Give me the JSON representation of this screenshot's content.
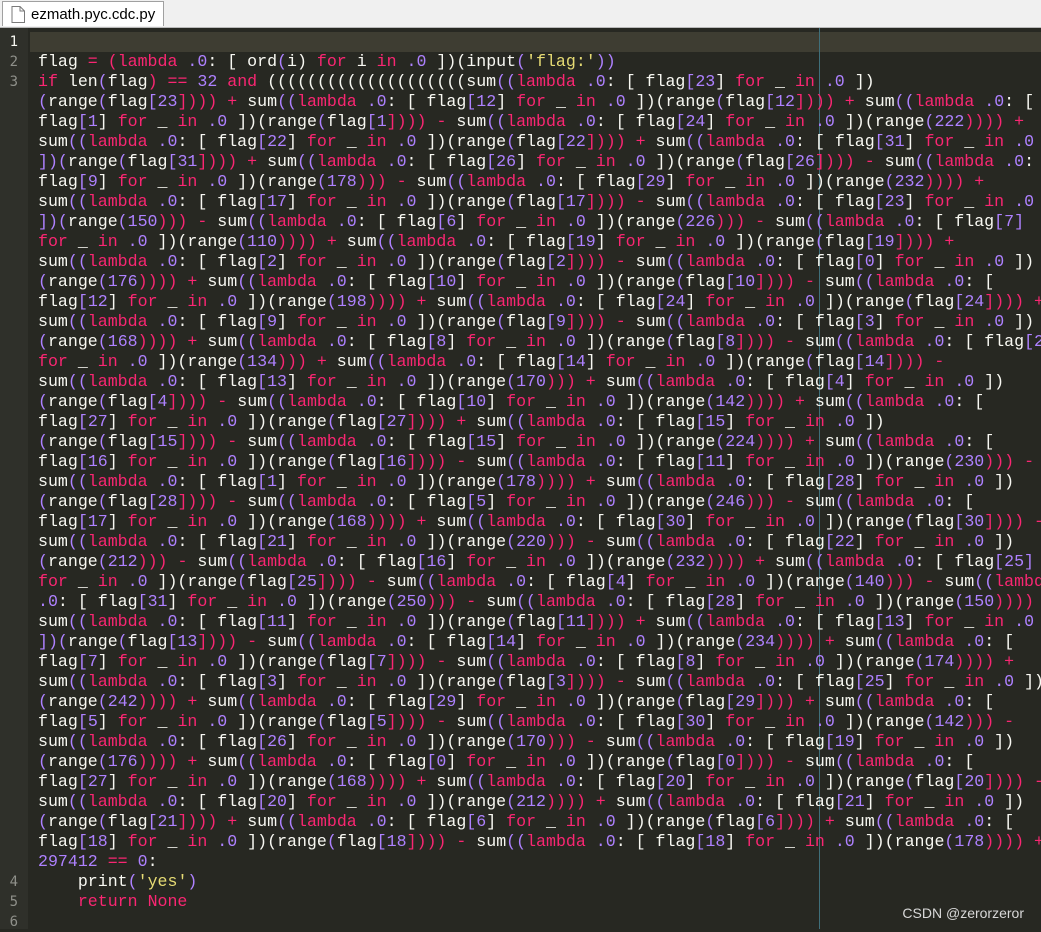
{
  "tab": {
    "title": "ezmath.pyc.cdc.py",
    "icon": "file-icon"
  },
  "gutter": {
    "line_numbers": [
      "1",
      "2",
      "3",
      "4",
      "5",
      "6"
    ]
  },
  "code": {
    "line2": "flag = (lambda .0: [ ord(i) for i in .0 ])(input('flag:'))",
    "line3_wrapped": [
      "if len(flag) == 32 and ((((((((((((((((((((sum((lambda .0: [ flag[23] for _ in .0 ])",
      "(range(flag[23]))) + sum((lambda .0: [ flag[12] for _ in .0 ])(range(flag[12]))) + sum((lambda .0: [",
      "flag[1] for _ in .0 ])(range(flag[1]))) - sum((lambda .0: [ flag[24] for _ in .0 ])(range(222)))) +",
      "sum((lambda .0: [ flag[22] for _ in .0 ])(range(flag[22]))) + sum((lambda .0: [ flag[31] for _ in .0",
      "])(range(flag[31]))) + sum((lambda .0: [ flag[26] for _ in .0 ])(range(flag[26]))) - sum((lambda .0: [",
      "flag[9] for _ in .0 ])(range(178))) - sum((lambda .0: [ flag[29] for _ in .0 ])(range(232)))) +",
      "sum((lambda .0: [ flag[17] for _ in .0 ])(range(flag[17]))) - sum((lambda .0: [ flag[23] for _ in .0",
      "])(range(150))) - sum((lambda .0: [ flag[6] for _ in .0 ])(range(226))) - sum((lambda .0: [ flag[7]",
      "for _ in .0 ])(range(110)))) + sum((lambda .0: [ flag[19] for _ in .0 ])(range(flag[19]))) +",
      "sum((lambda .0: [ flag[2] for _ in .0 ])(range(flag[2]))) - sum((lambda .0: [ flag[0] for _ in .0 ])",
      "(range(176)))) + sum((lambda .0: [ flag[10] for _ in .0 ])(range(flag[10]))) - sum((lambda .0: [",
      "flag[12] for _ in .0 ])(range(198)))) + sum((lambda .0: [ flag[24] for _ in .0 ])(range(flag[24]))) +",
      "sum((lambda .0: [ flag[9] for _ in .0 ])(range(flag[9]))) - sum((lambda .0: [ flag[3] for _ in .0 ])",
      "(range(168)))) + sum((lambda .0: [ flag[8] for _ in .0 ])(range(flag[8]))) - sum((lambda .0: [ flag[2]",
      "for _ in .0 ])(range(134))) + sum((lambda .0: [ flag[14] for _ in .0 ])(range(flag[14]))) -",
      "sum((lambda .0: [ flag[13] for _ in .0 ])(range(170))) + sum((lambda .0: [ flag[4] for _ in .0 ])",
      "(range(flag[4]))) - sum((lambda .0: [ flag[10] for _ in .0 ])(range(142)))) + sum((lambda .0: [",
      "flag[27] for _ in .0 ])(range(flag[27]))) + sum((lambda .0: [ flag[15] for _ in .0 ])",
      "(range(flag[15]))) - sum((lambda .0: [ flag[15] for _ in .0 ])(range(224)))) + sum((lambda .0: [",
      "flag[16] for _ in .0 ])(range(flag[16]))) - sum((lambda .0: [ flag[11] for _ in .0 ])(range(230))) -",
      "sum((lambda .0: [ flag[1] for _ in .0 ])(range(178)))) + sum((lambda .0: [ flag[28] for _ in .0 ])",
      "(range(flag[28]))) - sum((lambda .0: [ flag[5] for _ in .0 ])(range(246))) - sum((lambda .0: [",
      "flag[17] for _ in .0 ])(range(168)))) + sum((lambda .0: [ flag[30] for _ in .0 ])(range(flag[30]))) -",
      "sum((lambda .0: [ flag[21] for _ in .0 ])(range(220))) - sum((lambda .0: [ flag[22] for _ in .0 ])",
      "(range(212))) - sum((lambda .0: [ flag[16] for _ in .0 ])(range(232)))) + sum((lambda .0: [ flag[25]",
      "for _ in .0 ])(range(flag[25]))) - sum((lambda .0: [ flag[4] for _ in .0 ])(range(140))) - sum((lambda",
      ".0: [ flag[31] for _ in .0 ])(range(250))) - sum((lambda .0: [ flag[28] for _ in .0 ])(range(150)))) +",
      "sum((lambda .0: [ flag[11] for _ in .0 ])(range(flag[11]))) + sum((lambda .0: [ flag[13] for _ in .0",
      "])(range(flag[13]))) - sum((lambda .0: [ flag[14] for _ in .0 ])(range(234)))) + sum((lambda .0: [",
      "flag[7] for _ in .0 ])(range(flag[7]))) - sum((lambda .0: [ flag[8] for _ in .0 ])(range(174)))) +",
      "sum((lambda .0: [ flag[3] for _ in .0 ])(range(flag[3]))) - sum((lambda .0: [ flag[25] for _ in .0 ])",
      "(range(242)))) + sum((lambda .0: [ flag[29] for _ in .0 ])(range(flag[29]))) + sum((lambda .0: [",
      "flag[5] for _ in .0 ])(range(flag[5]))) - sum((lambda .0: [ flag[30] for _ in .0 ])(range(142))) -",
      "sum((lambda .0: [ flag[26] for _ in .0 ])(range(170))) - sum((lambda .0: [ flag[19] for _ in .0 ])",
      "(range(176)))) + sum((lambda .0: [ flag[0] for _ in .0 ])(range(flag[0]))) - sum((lambda .0: [",
      "flag[27] for _ in .0 ])(range(168)))) + sum((lambda .0: [ flag[20] for _ in .0 ])(range(flag[20]))) -",
      "sum((lambda .0: [ flag[20] for _ in .0 ])(range(212)))) + sum((lambda .0: [ flag[21] for _ in .0 ])",
      "(range(flag[21]))) + sum((lambda .0: [ flag[6] for _ in .0 ])(range(flag[6]))) + sum((lambda .0: [",
      "flag[18] for _ in .0 ])(range(flag[18]))) - sum((lambda .0: [ flag[18] for _ in .0 ])(range(178)))) +",
      "297412 == 0:"
    ],
    "line4": "    print('yes')",
    "line5": "    return None"
  },
  "watermark": "CSDN @zerorzeror"
}
